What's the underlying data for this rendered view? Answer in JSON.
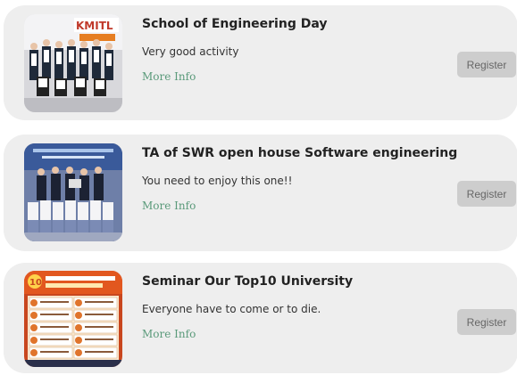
{
  "events": [
    {
      "title": "School of Engineering Day",
      "description": "Very good activity",
      "more_info_label": "More Info",
      "register_label": "Register",
      "thumbnail_text": "KMITL"
    },
    {
      "title": "TA of SWR open house Software engineering",
      "description": "You need to enjoy this one!!",
      "more_info_label": "More Info",
      "register_label": "Register"
    },
    {
      "title": "Seminar Our Top10 University",
      "description": "Everyone have to come or to die.",
      "more_info_label": "More Info",
      "register_label": "Register",
      "thumbnail_text": "10"
    }
  ],
  "colors": {
    "card_bg": "#eeeeee",
    "link": "#5a9a7a",
    "button_bg": "#cdcdcd",
    "button_text": "#666666"
  }
}
